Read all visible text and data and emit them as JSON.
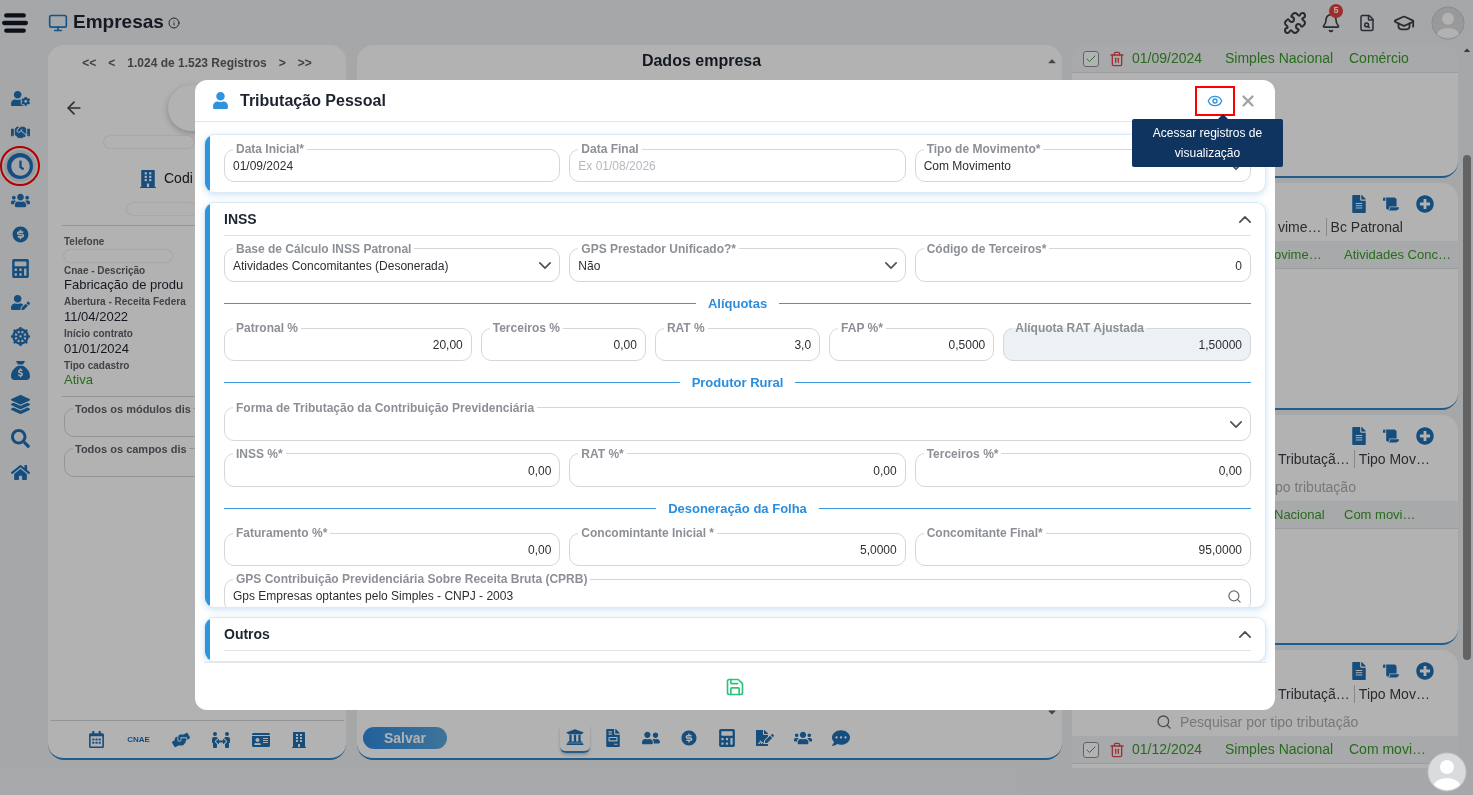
{
  "app": {
    "title": "Empresas",
    "notifications": "5"
  },
  "sidebar": {
    "items": [
      {
        "selected": false,
        "highlighted": false
      },
      {
        "selected": false,
        "highlighted": false
      },
      {
        "selected": true,
        "highlighted": true
      },
      {
        "selected": false,
        "highlighted": false
      },
      {
        "selected": false,
        "highlighted": false
      },
      {
        "selected": false,
        "highlighted": false
      },
      {
        "selected": false,
        "highlighted": false
      },
      {
        "selected": false,
        "highlighted": false
      },
      {
        "selected": false,
        "highlighted": false
      },
      {
        "selected": false,
        "highlighted": false
      },
      {
        "selected": false,
        "highlighted": false
      },
      {
        "selected": false,
        "highlighted": false
      }
    ]
  },
  "record_nav": {
    "first": "<<",
    "prev": "<",
    "label": "1.024 de 1.523 Registros",
    "next": ">",
    "last": ">>"
  },
  "company": {
    "code_label": "Codi",
    "fields": [
      {
        "label": "Telefone",
        "redacted": true
      },
      {
        "label": "Cnae - Descrição",
        "value": "Fabricação de produ",
        "redacted": false,
        "kind": "text"
      },
      {
        "label": "Abertura - Receita Federa",
        "value": "11/04/2022",
        "redacted": false,
        "kind": "text"
      },
      {
        "label": "Início contrato",
        "value": "01/01/2024",
        "redacted": false,
        "kind": "text"
      },
      {
        "label": "Tipo cadastro",
        "value": "Ativa",
        "redacted": false,
        "kind": "status"
      }
    ],
    "boxes": [
      "Todos os módulos dis",
      "Todos os campos dis"
    ],
    "toolbar_text": "CNAE"
  },
  "main_panel": {
    "title": "Dados empresa",
    "save": "Salvar",
    "tabs": [
      {
        "selected": true
      },
      {
        "selected": false
      },
      {
        "selected": false
      },
      {
        "selected": false
      },
      {
        "selected": false
      },
      {
        "selected": false
      },
      {
        "selected": false
      },
      {
        "selected": false
      }
    ]
  },
  "records_panel": {
    "cards": [
      {
        "toolbar": false,
        "rows": [
          {
            "kind": "full",
            "checked": true,
            "cells": [
              "01/09/2024",
              "Simples Nacional",
              "Comércio"
            ]
          }
        ]
      },
      {
        "toolbar": true,
        "headers": [
          "vime…",
          "Bc Patronal"
        ],
        "rows": [
          {
            "kind": "partial",
            "cells": [
              "ovime…",
              "Atividades Conc…"
            ]
          }
        ]
      },
      {
        "toolbar": true,
        "headers": [
          "Tributaçã…",
          "Tipo Mov…"
        ],
        "search": {
          "placeholder": "po tributação",
          "icon": false
        },
        "rows": [
          {
            "kind": "partial",
            "cells": [
              "Nacional",
              "Com movi…"
            ]
          }
        ]
      },
      {
        "toolbar": true,
        "headers": [
          "Tributaçã…",
          "Tipo Mov…"
        ],
        "search": {
          "placeholder": "Pesquisar por tipo tributação",
          "icon": true
        },
        "rows": [
          {
            "kind": "full",
            "checked": true,
            "cells": [
              "01/12/2024",
              "Simples Nacional",
              "Com movi…"
            ]
          }
        ]
      }
    ]
  },
  "modal": {
    "title": "Tributação Pessoal",
    "view_button": {
      "highlighted": true
    },
    "tooltip": "Acessar registros de visualização",
    "sections": [
      {
        "rows": [
          {
            "kind": "fields",
            "fields": [
              {
                "label": "Data Inicial*",
                "value": "01/09/2024",
                "kind": "text",
                "disabled": false
              },
              {
                "label": "Data Final",
                "placeholder": "Ex 01/08/2026",
                "kind": "text",
                "disabled": false
              },
              {
                "label": "Tipo de Movimento*",
                "value": "Com Movimento",
                "kind": "select",
                "disabled": false
              }
            ]
          }
        ]
      },
      {
        "title": "INSS",
        "expanded": true,
        "rows": [
          {
            "kind": "fields",
            "fields": [
              {
                "label": "Base de Cálculo INSS Patronal",
                "value": "Atividades Concomitantes (Desonerada)",
                "kind": "select",
                "disabled": false
              },
              {
                "label": "GPS Prestador Unificado?*",
                "value": "Não",
                "kind": "select",
                "disabled": false
              },
              {
                "label": "Código de Terceiros*",
                "value": "0",
                "kind": "number",
                "disabled": false
              }
            ]
          },
          {
            "kind": "heading",
            "text": "Alíquotas"
          },
          {
            "kind": "fields",
            "fields": [
              {
                "label": "Patronal %",
                "value": "20,00",
                "kind": "number",
                "disabled": false
              },
              {
                "label": "Terceiros %",
                "value": "0,00",
                "kind": "number",
                "disabled": false
              },
              {
                "label": "RAT %",
                "value": "3,0",
                "kind": "number",
                "disabled": false
              },
              {
                "label": "FAP %*",
                "value": "0,5000",
                "kind": "number",
                "disabled": false
              },
              {
                "label": "Alíquota RAT Ajustada",
                "value": "1,50000",
                "kind": "number",
                "disabled": true
              }
            ]
          },
          {
            "kind": "heading",
            "text": "Produtor Rural"
          },
          {
            "kind": "fields",
            "fields": [
              {
                "label": "Forma de Tributação da Contribuição Previdenciária",
                "kind": "select",
                "disabled": false
              }
            ]
          },
          {
            "kind": "fields",
            "fields": [
              {
                "label": "INSS %*",
                "value": "0,00",
                "kind": "number",
                "disabled": false
              },
              {
                "label": "RAT %*",
                "value": "0,00",
                "kind": "number",
                "disabled": false
              },
              {
                "label": "Terceiros %*",
                "value": "0,00",
                "kind": "number",
                "disabled": false
              }
            ]
          },
          {
            "kind": "heading",
            "text": "Desoneração da Folha"
          },
          {
            "kind": "fields",
            "fields": [
              {
                "label": "Faturamento %*",
                "value": "0,00",
                "kind": "number",
                "disabled": false
              },
              {
                "label": "Concomintante Inicial *",
                "value": "5,0000",
                "kind": "number",
                "disabled": false
              },
              {
                "label": "Concomitante Final*",
                "value": "95,0000",
                "kind": "number",
                "disabled": false
              }
            ]
          },
          {
            "kind": "fields",
            "fields": [
              {
                "label": "GPS Contribuição Previdenciária Sobre Receita Bruta (CPRB)",
                "value": "Gps Empresas optantes pelo Simples - CNPJ - 2003",
                "kind": "search",
                "disabled": false
              }
            ]
          }
        ]
      },
      {
        "title": "Outros",
        "expanded": true
      }
    ]
  }
}
